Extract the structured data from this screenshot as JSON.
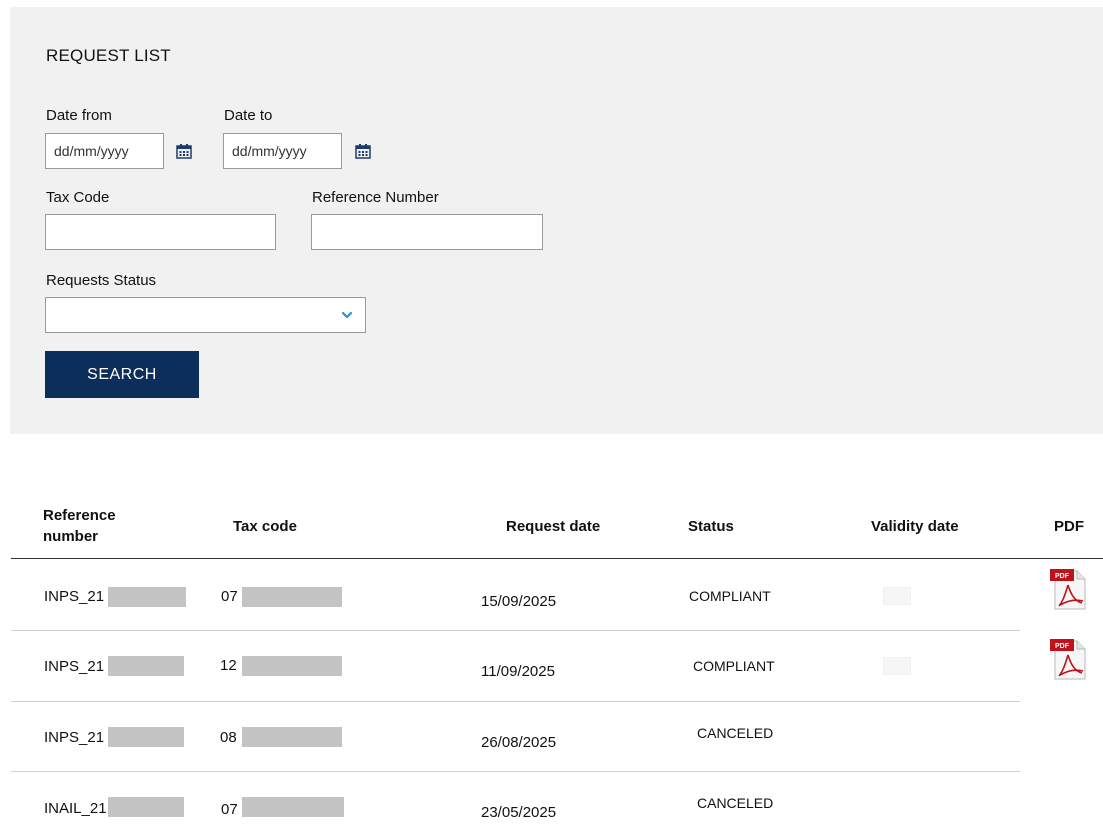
{
  "form": {
    "title": "REQUEST LIST",
    "date_from_label": "Date from",
    "date_to_label": "Date to",
    "date_placeholder": "dd/mm/yyyy",
    "tax_code_label": "Tax Code",
    "reference_number_label": "Reference Number",
    "requests_status_label": "Requests Status",
    "requests_status_value": "",
    "search_label": "SEARCH"
  },
  "table": {
    "headers": {
      "reference_line1": "Reference",
      "reference_line2": "number",
      "tax_code": "Tax code",
      "request_date": "Request date",
      "status": "Status",
      "validity_date": "Validity date",
      "pdf": "PDF"
    },
    "rows": [
      {
        "reference_prefix": "INPS_21",
        "tax_prefix": "07",
        "request_date": "15/09/2025",
        "status": "COMPLIANT",
        "has_pdf": true
      },
      {
        "reference_prefix": "INPS_21",
        "tax_prefix": "12",
        "request_date": "11/09/2025",
        "status": "COMPLIANT",
        "has_pdf": true
      },
      {
        "reference_prefix": "INPS_21",
        "tax_prefix": "08",
        "request_date": "26/08/2025",
        "status": "CANCELED",
        "has_pdf": false
      },
      {
        "reference_prefix": "INAIL_21",
        "tax_prefix": "07",
        "request_date": "23/05/2025",
        "status": "CANCELED",
        "has_pdf": false
      }
    ]
  },
  "icons": {
    "calendar": "calendar-icon",
    "chevron": "chevron-down-icon",
    "pdf": "pdf-icon"
  },
  "colors": {
    "panel_bg": "#f1f1f2",
    "button_bg": "#0c2e5a",
    "accent_icon": "#1e3a6b",
    "chevron": "#2a8fd8",
    "redaction": "#c4c4c4",
    "pdf_red": "#c0121a"
  }
}
